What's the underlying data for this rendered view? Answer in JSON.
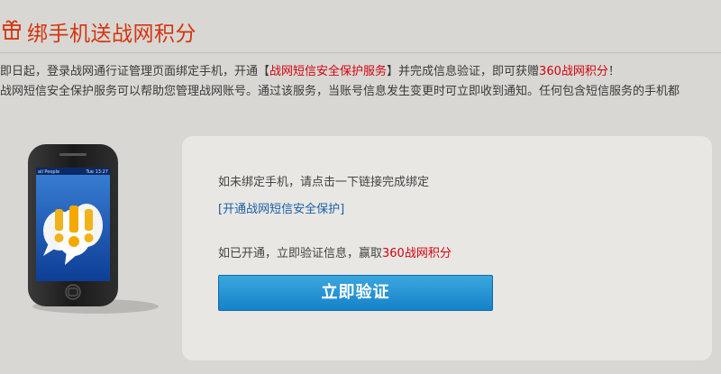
{
  "header": {
    "icon": "gift-icon",
    "title": "绑手机送战网积分",
    "accent_color": "#d4350f"
  },
  "intro": {
    "line1_prefix": "即日起，登录战网通行证管理页面绑定手机，开通【",
    "line1_service": "战网短信安全保护服务",
    "line1_middle": "】并完成信息验证，即可获赠",
    "line1_reward": "360战网积分",
    "line1_suffix": "！",
    "line2": "战网短信安全保护服务可以帮助您管理战网账号。通过该服务，当账号信息发生变更时可立即收到通知。任何包含短信服务的手机都",
    "highlight_color": "#d4030f"
  },
  "phone": {
    "icon": "smartphone-icon",
    "status_left": "all People",
    "status_right": "Tue 13:27",
    "screen_icon": "exclamation-speech-bubbles-icon"
  },
  "panel": {
    "bind_prompt": "如未绑定手机，请点击一下链接完成绑定",
    "bind_link": "[开通战网短信安全保护]",
    "verify_prefix": "如已开通，立即验证信息，赢取",
    "verify_reward": "360战网积分",
    "verify_button": "立即验证",
    "button_color": "#1a8ad0"
  }
}
